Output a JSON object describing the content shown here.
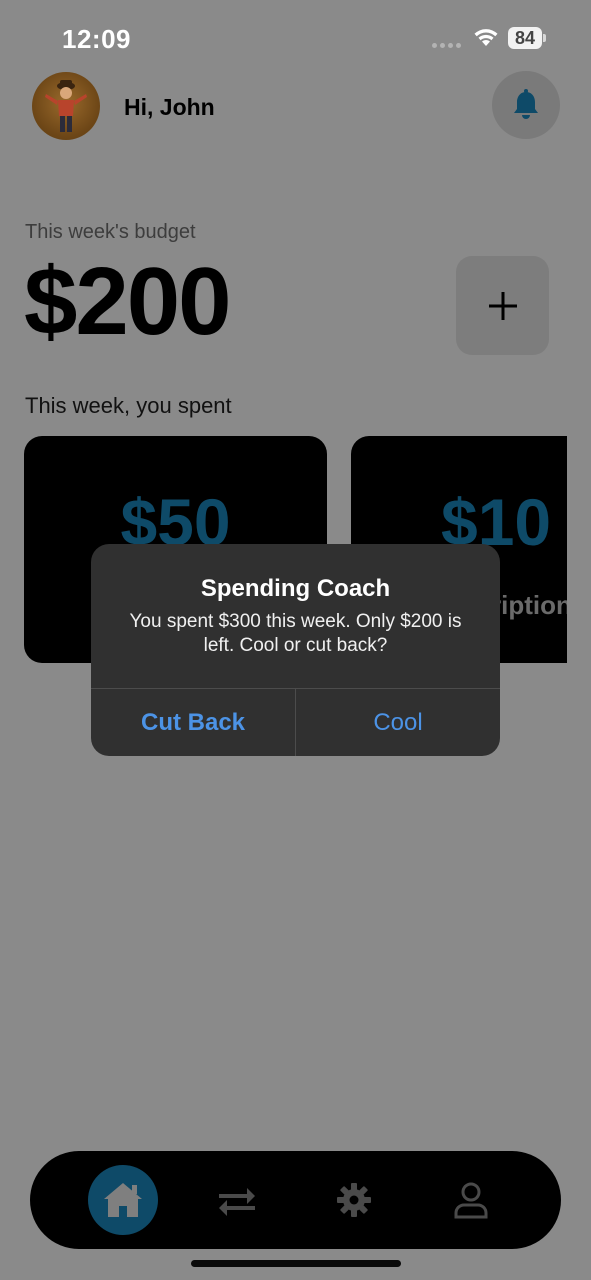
{
  "status_bar": {
    "time": "12:09",
    "battery": "84"
  },
  "header": {
    "greeting": "Hi, John",
    "avatar": "user-avatar",
    "notification_icon": "bell-icon"
  },
  "budget": {
    "label": "This week's budget",
    "amount": "$200",
    "add_icon": "plus-icon"
  },
  "spending": {
    "label": "This week, you spent",
    "cards": [
      {
        "amount": "$50",
        "caption": ""
      },
      {
        "amount": "$10",
        "caption": "ription"
      }
    ]
  },
  "alert": {
    "title": "Spending Coach",
    "message": "You spent $300 this week. Only $200 is left. Cool or cut back?",
    "buttons": [
      "Cut Back",
      "Cool"
    ]
  },
  "tab_bar": {
    "tabs": [
      {
        "icon": "home-icon",
        "active": true
      },
      {
        "icon": "transfer-icon",
        "active": false
      },
      {
        "icon": "gear-icon",
        "active": false
      },
      {
        "icon": "user-icon",
        "active": false
      }
    ]
  },
  "colors": {
    "accent": "#0e4a68",
    "alert_button": "#4c93e6",
    "overlay": "#8a8a8a"
  }
}
